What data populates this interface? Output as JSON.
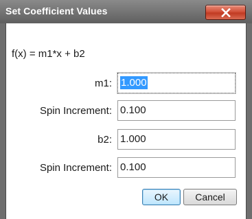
{
  "window": {
    "title": "Set Coefficient Values",
    "close_icon": "close-icon",
    "close_color": "#c13a22"
  },
  "form": {
    "formula": "f(x) = m1*x + b2",
    "fields": [
      {
        "label": "m1:",
        "value": "1.000",
        "selected": true
      },
      {
        "label": "Spin Increment:",
        "value": "0.100"
      },
      {
        "label": "b2:",
        "value": "1.000"
      },
      {
        "label": "Spin Increment:",
        "value": "0.100"
      }
    ]
  },
  "buttons": {
    "ok": "OK",
    "cancel": "Cancel"
  },
  "colors": {
    "selection": "#3399ff",
    "default_button": "#bee6fd"
  }
}
